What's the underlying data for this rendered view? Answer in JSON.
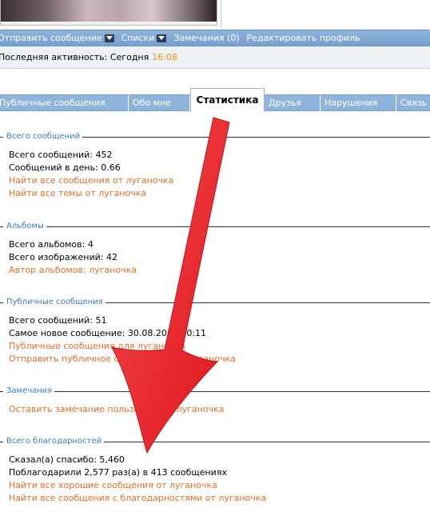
{
  "action_bar": {
    "send_message": "Отправить сообщение",
    "lists": "Списки",
    "remarks": "Замечания (0)",
    "edit_profile": "Редактировать профиль"
  },
  "activity": {
    "label": "Последняя активность: Сегодня",
    "time": "16:08"
  },
  "tabs": [
    {
      "label": "Публичные сообщения"
    },
    {
      "label": "Обо мне"
    },
    {
      "label": "Статистика"
    },
    {
      "label": "Друзья"
    },
    {
      "label": "Нарушения"
    },
    {
      "label": "Связь"
    }
  ],
  "sections": {
    "messages": {
      "title": "Всего сообщений",
      "total": "Всего сообщений: 452",
      "per_day": "Сообщений в день: 0.66",
      "find_posts": "Найти все сообщения от луганочка",
      "find_threads": "Найти все темы от луганочка"
    },
    "albums": {
      "title": "Альбомы",
      "total_albums": "Всего альбомов: 4",
      "total_images": "Всего изображений: 42",
      "author": "Автор альбомов: луганочка"
    },
    "public": {
      "title": "Публичные сообщения",
      "total": "Всего сообщений: 51",
      "newest": "Самое новое сообщение: 30.08.2011 20:11",
      "for_user": "Публичные сообщения для луганочка",
      "send": "Отправить публичное сообщение для луганочка"
    },
    "remarks": {
      "title": "Замечания",
      "leave": "Оставить замечание пользователю луганочка"
    },
    "thanks": {
      "title": "Всего благодарностей",
      "said": "Сказал(а) спасибо: 5,460",
      "thanked": "Поблагодарили 2,577 раз(а) в 413 сообщениях",
      "find_good": "Найти все хорошие сообщения от луганочка",
      "find_thanked": "Найти все сообщения с благодарностями от луганочка"
    }
  },
  "colors": {
    "accent_blue": "#8fb4dc",
    "link_orange": "#e8702a",
    "legend_blue": "#3a7cc8",
    "arrow_red": "#f0282e"
  },
  "icons": {
    "dropdown": "triangle-down-icon",
    "arrow": "red-arrow-annotation"
  }
}
